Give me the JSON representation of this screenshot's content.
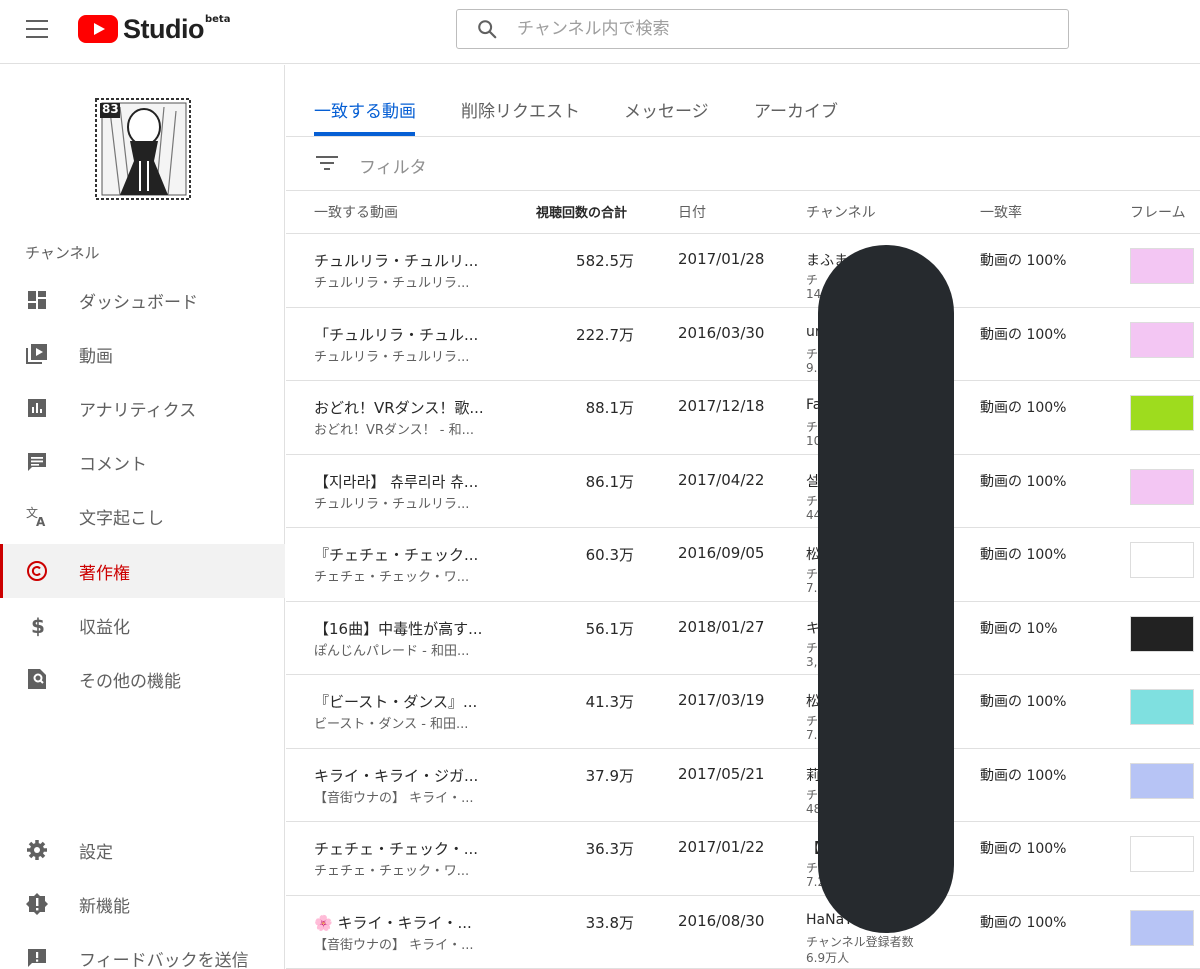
{
  "header": {
    "logo_text": "Studio",
    "logo_badge": "beta",
    "search_placeholder": "チャンネル内で検索"
  },
  "sidebar": {
    "avatar_number": "83",
    "section_label": "チャンネル",
    "items": [
      {
        "label": "ダッシュボード",
        "icon": "dashboard-icon"
      },
      {
        "label": "動画",
        "icon": "video-icon"
      },
      {
        "label": "アナリティクス",
        "icon": "analytics-icon"
      },
      {
        "label": "コメント",
        "icon": "comment-icon"
      },
      {
        "label": "文字起こし",
        "icon": "translate-icon"
      },
      {
        "label": "著作権",
        "icon": "copyright-icon",
        "active": true
      },
      {
        "label": "収益化",
        "icon": "dollar-icon"
      },
      {
        "label": "その他の機能",
        "icon": "more-features-icon"
      }
    ],
    "bottom_items": [
      {
        "label": "設定",
        "icon": "gear-icon"
      },
      {
        "label": "新機能",
        "icon": "alert-icon"
      },
      {
        "label": "フィードバックを送信",
        "icon": "feedback-icon"
      }
    ]
  },
  "tabs": [
    {
      "label": "一致する動画",
      "active": true
    },
    {
      "label": "削除リクエスト"
    },
    {
      "label": "メッセージ"
    },
    {
      "label": "アーカイブ"
    }
  ],
  "filter_label": "フィルタ",
  "columns": {
    "video": "一致する動画",
    "views": "視聴回数の合計",
    "date": "日付",
    "channel": "チャンネル",
    "match": "一致率",
    "frame": "フレーム"
  },
  "rows": [
    {
      "title": "チュルリラ・チュルリ...",
      "subtitle": "チュルリラ・チュルリラ...",
      "views": "582.5万",
      "date": "2017/01/28",
      "channel": "まふま",
      "channel_line2": "チ",
      "channel_line3": "14",
      "match": "動画の 100%",
      "frame_color": "#f3c6f3"
    },
    {
      "title": "「チュルリラ・チュル...",
      "subtitle": "チュルリラ・チュルリラ...",
      "views": "222.7万",
      "date": "2016/03/30",
      "channel": "ur",
      "channel_line2": "チ",
      "channel_line3": "9.",
      "match": "動画の 100%",
      "frame_color": "#f3c6f3"
    },
    {
      "title": "おどれ！VRダンス！歌...",
      "subtitle": "おどれ！VRダンス！ - 和...",
      "views": "88.1万",
      "date": "2017/12/18",
      "channel": "Fa",
      "channel_line2": "チ",
      "channel_line3": "10",
      "match": "動画の 100%",
      "frame_color": "#9edc1e"
    },
    {
      "title": "【지라라】 츄루리라 츄...",
      "subtitle": "チュルリラ・チュルリラ...",
      "views": "86.1万",
      "date": "2017/04/22",
      "channel": "설",
      "channel_line2": "チ",
      "channel_line3": "44",
      "match": "動画の 100%",
      "frame_color": "#f3c6f3"
    },
    {
      "title": "『チェチェ・チェック...",
      "subtitle": "チェチェ・チェック・ワ...",
      "views": "60.3万",
      "date": "2016/09/05",
      "channel": "松",
      "channel_line2": "チ",
      "channel_line3": "7.",
      "match": "動画の 100%",
      "frame_color": "#ffffff"
    },
    {
      "title": "【16曲】中毒性が高す...",
      "subtitle": "ぽんじんパレード - 和田...",
      "views": "56.1万",
      "date": "2018/01/27",
      "channel": "キ",
      "channel_line2": "チ",
      "channel_line3": "3,",
      "match": "動画の 10%",
      "frame_color": "#222222"
    },
    {
      "title": "『ビースト・ダンス』...",
      "subtitle": "ビースト・ダンス - 和田...",
      "views": "41.3万",
      "date": "2017/03/19",
      "channel": "松",
      "channel_line2": "チ",
      "channel_line3": "7.1",
      "match": "動画の 100%",
      "frame_color": "#7fe0e0"
    },
    {
      "title": "キライ・キライ・ジガ...",
      "subtitle": "【音街ウナの】 キライ・...",
      "views": "37.9万",
      "date": "2017/05/21",
      "channel": "莉",
      "channel_line2": "チ",
      "channel_line3": "48.",
      "match": "動画の 100%",
      "frame_color": "#b7c4f5"
    },
    {
      "title": "チェチェ・チェック・...",
      "subtitle": "チェチェ・チェック・ワ...",
      "views": "36.3万",
      "date": "2017/01/22",
      "channel": "【",
      "channel_line2": "チ",
      "channel_line3": "7.2",
      "match": "動画の 100%",
      "frame_color": "#ffffff"
    },
    {
      "title": "🌸 キライ・キライ・...",
      "subtitle": "【音街ウナの】 キライ・...",
      "views": "33.8万",
      "date": "2016/08/30",
      "channel": "HaNaTa",
      "channel_line2": "チャンネル登録者数",
      "channel_line3": "6.9万人",
      "match": "動画の 100%",
      "frame_color": "#b7c4f5"
    }
  ]
}
